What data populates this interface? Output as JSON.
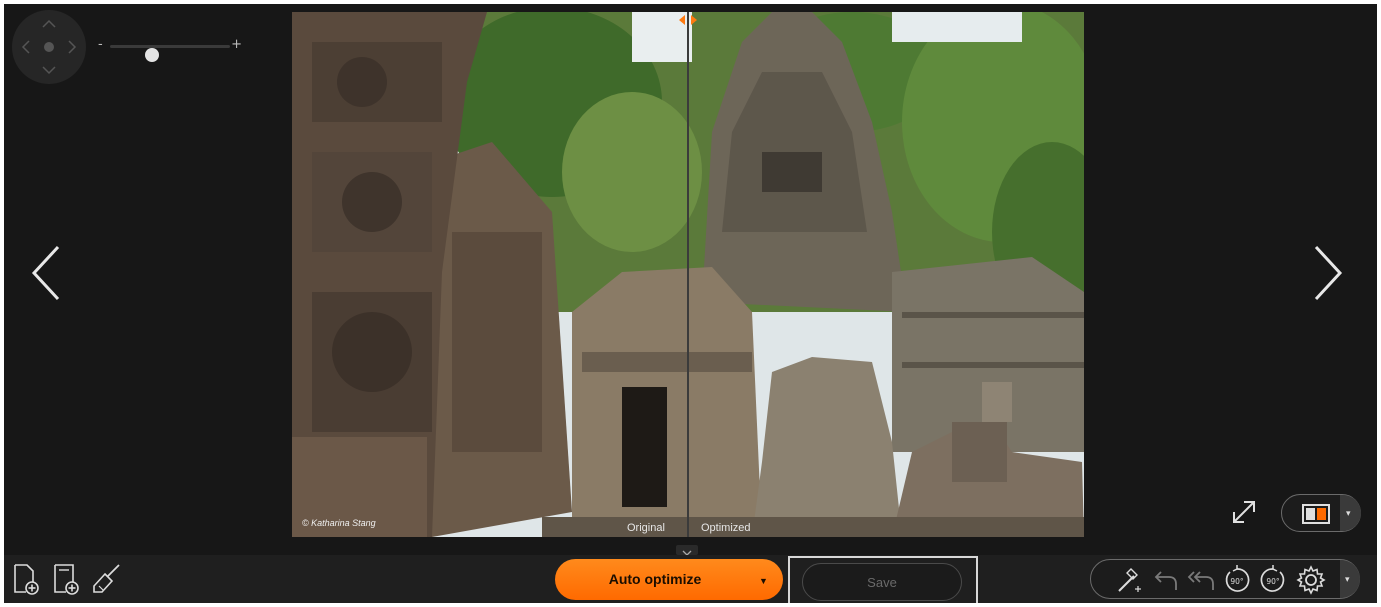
{
  "zoom": {
    "minus_label": "-",
    "plus_label": "+",
    "level": 0.35
  },
  "photo": {
    "credit": "© Katharina Stang",
    "left_label": "Original",
    "right_label": "Optimized"
  },
  "toolbar": {
    "auto_optimize_label": "Auto optimize",
    "save_label": "Save"
  },
  "icons": {
    "nav": "navigation-pad-icon",
    "prev": "chevron-left-icon",
    "next": "chevron-right-icon",
    "fullscreen": "expand-icon",
    "compare": "split-view-icon",
    "add_file": "add-file-icon",
    "add_folder": "add-folder-icon",
    "clear": "broom-icon",
    "magic": "magic-wand-icon",
    "undo": "undo-icon",
    "undo_all": "undo-all-icon",
    "rotate_left": "rotate-left-90-icon",
    "rotate_right": "rotate-right-90-icon",
    "settings": "gear-icon"
  },
  "colors": {
    "accent": "#ff7a10",
    "background": "#171717",
    "toolbar": "#1f1f1f"
  }
}
